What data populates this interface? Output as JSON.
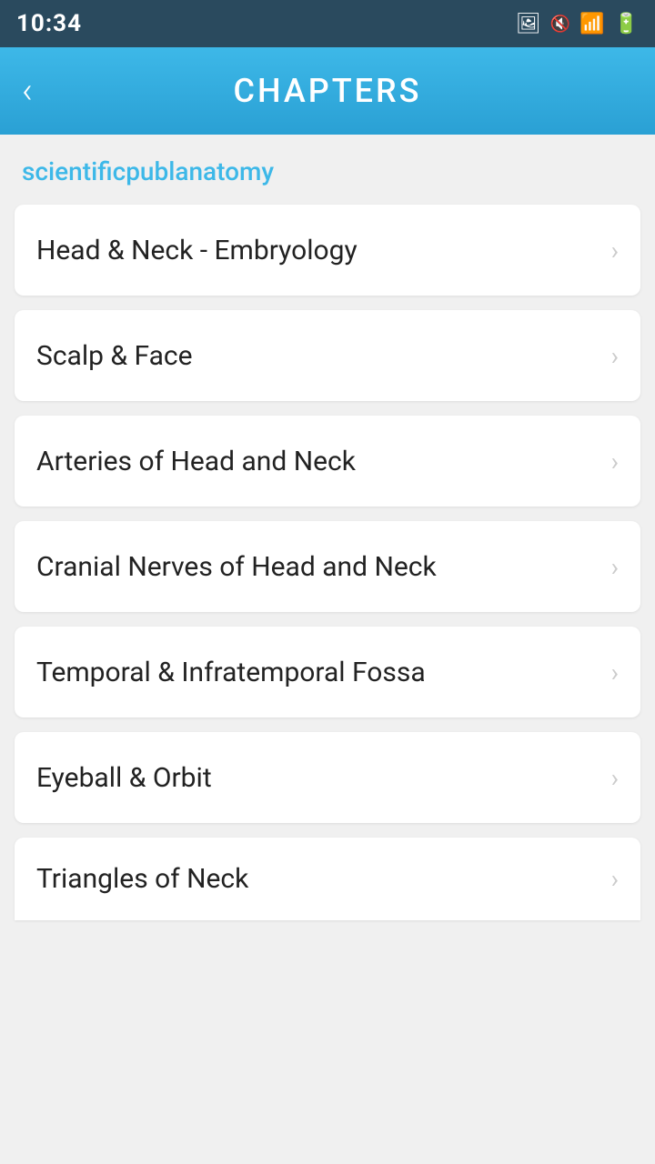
{
  "statusBar": {
    "time": "10:34",
    "icons": [
      "image",
      "signal-mute",
      "wifi",
      "cellular",
      "battery"
    ]
  },
  "appBar": {
    "title": "CHAPTERS",
    "backLabel": "‹"
  },
  "content": {
    "publisher": "scientificpublanatomy",
    "chapters": [
      {
        "id": 1,
        "label": "Head & Neck - Embryology"
      },
      {
        "id": 2,
        "label": "Scalp & Face"
      },
      {
        "id": 3,
        "label": "Arteries of Head and Neck"
      },
      {
        "id": 4,
        "label": "Cranial Nerves of Head and Neck"
      },
      {
        "id": 5,
        "label": "Temporal & Infratemporal Fossa"
      },
      {
        "id": 6,
        "label": "Eyeball & Orbit"
      },
      {
        "id": 7,
        "label": "Triangles of Neck"
      }
    ]
  }
}
